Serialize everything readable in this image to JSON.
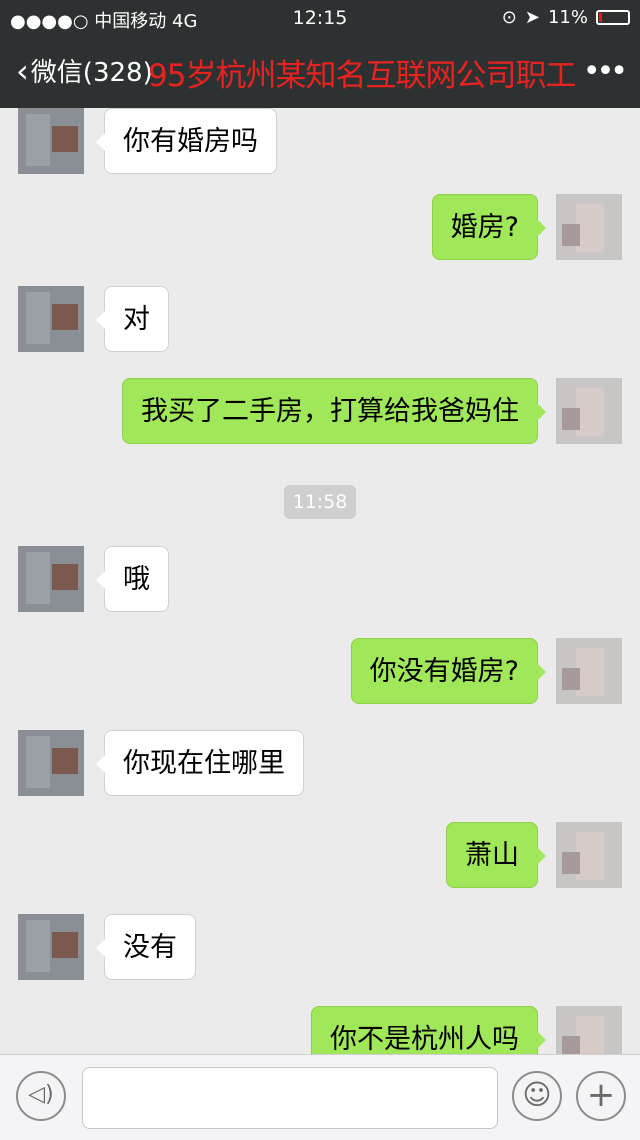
{
  "status_bar": {
    "signal": "●●●●○",
    "carrier": "中国移动",
    "network": "4G",
    "time": "12:15",
    "battery": "11%",
    "battery_level": 0.11,
    "battery_color": "#e02020"
  },
  "nav": {
    "back_label": "微信(328)",
    "title": "95岁杭州某知名互联网公司职工",
    "more_icon": "more-dots-icon"
  },
  "messages": [
    {
      "from": "other",
      "text": "你有婚房吗"
    },
    {
      "from": "me",
      "text": "婚房?"
    },
    {
      "from": "other",
      "text": "对"
    },
    {
      "from": "me",
      "text": "我买了二手房，打算给我爸妈住"
    },
    {
      "from": "time",
      "text": "11:58"
    },
    {
      "from": "other",
      "text": "哦"
    },
    {
      "from": "me",
      "text": "你没有婚房?"
    },
    {
      "from": "other",
      "text": "你现在住哪里"
    },
    {
      "from": "me",
      "text": "萧山"
    },
    {
      "from": "other",
      "text": "没有"
    },
    {
      "from": "me",
      "text": "你不是杭州人吗"
    }
  ],
  "input_bar": {
    "voice_icon": "voice-icon",
    "emoji_icon": "emoji-icon",
    "plus_icon": "plus-icon"
  },
  "colors": {
    "nav_bg": "#2e3132",
    "title_red": "#e8231f",
    "bubble_out": "#a0e75a",
    "bubble_in": "#ffffff",
    "chat_bg": "#ebebeb"
  }
}
